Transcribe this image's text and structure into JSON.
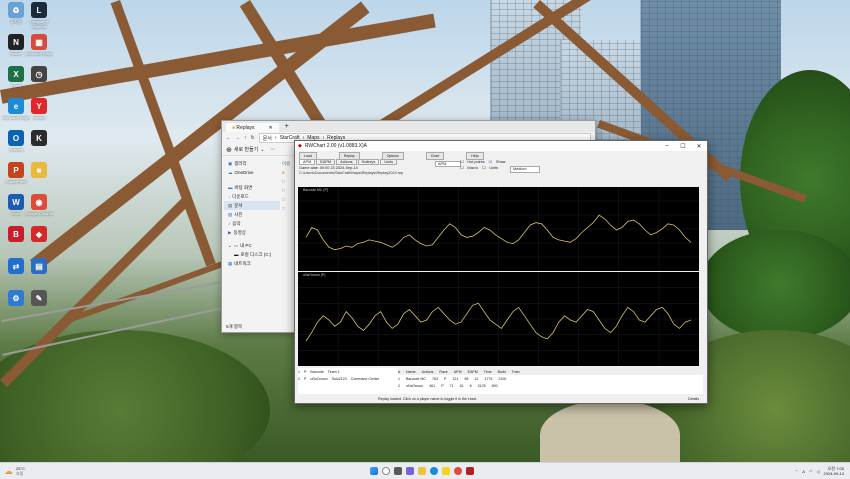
{
  "desktop_icons": [
    {
      "label": "휴지통",
      "icon": "recycle-bin-icon",
      "color": "#6aa0d8",
      "glyph": "♻"
    },
    {
      "label": "League of Legends",
      "icon": "league-icon",
      "color": "#1c2a3a",
      "glyph": "L"
    },
    {
      "label": "Notion",
      "icon": "notion-icon",
      "color": "#222222",
      "glyph": "N"
    },
    {
      "label": "Microsoft Edge",
      "icon": "calendar-icon",
      "color": "#d9493e",
      "glyph": "▦"
    },
    {
      "label": "Excel",
      "icon": "excel-icon",
      "color": "#1e7145",
      "glyph": "X"
    },
    {
      "label": "",
      "icon": "clock-icon",
      "color": "#444444",
      "glyph": "◷"
    },
    {
      "label": "Microsoft Edge",
      "icon": "edge-icon",
      "color": "#1b8ad8",
      "glyph": "e"
    },
    {
      "label": "Yandex",
      "icon": "yandex-icon",
      "color": "#e3262c",
      "glyph": "Y"
    },
    {
      "label": "Outlook",
      "icon": "outlook-icon",
      "color": "#0a64b4",
      "glyph": "O"
    },
    {
      "label": "",
      "icon": "app-icon",
      "color": "#2b2b2b",
      "glyph": "K"
    },
    {
      "label": "PowerPoint",
      "icon": "powerpoint-icon",
      "color": "#c4441e",
      "glyph": "P"
    },
    {
      "label": "",
      "icon": "folder-icon",
      "color": "#e8b93c",
      "glyph": "■"
    },
    {
      "label": "Word",
      "icon": "word-icon",
      "color": "#1c5bb5",
      "glyph": "W"
    },
    {
      "label": "Google Chrome",
      "icon": "chrome-icon",
      "color": "#dd4b39",
      "glyph": "◉"
    },
    {
      "label": "",
      "icon": "bandizip-icon",
      "color": "#c81e2c",
      "glyph": "B"
    },
    {
      "label": "",
      "icon": "v3-icon",
      "color": "#d62828",
      "glyph": "◆"
    },
    {
      "label": "",
      "icon": "teamviewer-icon",
      "color": "#1f6fd0",
      "glyph": "⇄"
    },
    {
      "label": "",
      "icon": "calc-icon",
      "color": "#2b6cc4",
      "glyph": "▤"
    },
    {
      "label": "",
      "icon": "network-icon",
      "color": "#2d7bd5",
      "glyph": "⚙"
    },
    {
      "label": "",
      "icon": "tool-icon",
      "color": "#555555",
      "glyph": "✎"
    }
  ],
  "explorer": {
    "tab_title": "Replays",
    "breadcrumb": [
      "문서",
      "StarCraft",
      "Maps",
      "Replays"
    ],
    "new_button": "새로 만들기",
    "sidebar": [
      "갤러리",
      "OneDrive",
      "바탕 화면",
      "다운로드",
      "문서",
      "사진",
      "음악",
      "동영상",
      "내 PC",
      "로컬 디스크 (C:)",
      "네트워크"
    ],
    "list_header": "이름",
    "list_items": [
      "Rand",
      "rep",
      "rep",
      "rep",
      "rep"
    ],
    "status": "5개 항목"
  },
  "rwchart": {
    "title": "RWChart 2.00 (v1.0883.X)A",
    "toolbar": [
      "Load",
      "Replay",
      "Options",
      "Chart",
      "Help"
    ],
    "tab_labels": [
      "APM",
      "EAPM",
      "Actions",
      "Hotkeys",
      "Units"
    ],
    "replay_info": "Game date: 00:00 23 2024-Sep-14",
    "file_path": "C:\\Users\\Documents\\StarCraft\\Maps\\Replays\\Replay2024.rep",
    "chart_type_select": "APM",
    "smoothing_select": "Medium",
    "options": [
      "Hot points",
      "Show",
      "Macro",
      "Units"
    ],
    "chart1_label": "Barcode MC (P)",
    "chart2_label": "uNxOnoon (P)",
    "table_headers": [
      "#",
      "Name",
      "Actions",
      "Race",
      "APM",
      "EAPM",
      "Time",
      "Build",
      "Train"
    ],
    "table_rows": [
      [
        "1",
        "Barcode MC",
        "763",
        "P",
        "121",
        "98",
        "12",
        "1775",
        "2100"
      ],
      [
        "2",
        "uNxOnoon",
        "461",
        "P",
        "71",
        "61",
        "8",
        "3125",
        "800"
      ]
    ],
    "player_rows": [
      {
        "num": "1",
        "race": "P",
        "name": "Barcode",
        "actions": "SoloPlayer",
        "team": "Team 1"
      },
      {
        "num": "2",
        "race": "P",
        "name": "uNxOnoon",
        "actions": "Solo2123",
        "team": "Command Center"
      }
    ],
    "status_text": "Replay loaded. Click on a player name to toggle it in the chart.",
    "right_status": "Details"
  },
  "taskbar": {
    "weather_temp": "25°C",
    "weather_desc": "흐림",
    "time": "오전 7:05",
    "date": "2024-09-14",
    "lang": "A"
  },
  "chart_data": [
    {
      "type": "line",
      "title": "Barcode MC (P)",
      "series": [
        {
          "name": "APM",
          "values": [
            120,
            160,
            150,
            110,
            80,
            70,
            75,
            85,
            80,
            95,
            100,
            110,
            105,
            100,
            90,
            80,
            95,
            120,
            130,
            110,
            95,
            85,
            90,
            120,
            150,
            175,
            160,
            130,
            120,
            125,
            140,
            160,
            150,
            130,
            115,
            100,
            95,
            110,
            140,
            170,
            180,
            175,
            150,
            120,
            110,
            105,
            100,
            115,
            140,
            160,
            180,
            210,
            195,
            170,
            150,
            160,
            185,
            190,
            175,
            150,
            130,
            140,
            155,
            175,
            170,
            150,
            120,
            100
          ]
        }
      ],
      "ylim": [
        0,
        300
      ]
    },
    {
      "type": "line",
      "title": "uNxOnoon (P)",
      "series": [
        {
          "name": "APM",
          "values": [
            50,
            70,
            95,
            110,
            100,
            85,
            95,
            120,
            105,
            85,
            75,
            90,
            110,
            120,
            95,
            80,
            90,
            115,
            125,
            110,
            95,
            100,
            120,
            130,
            115,
            100,
            90,
            95,
            115,
            135,
            140,
            120,
            100,
            90,
            80,
            100,
            120,
            130,
            110,
            90,
            70,
            60,
            55,
            70,
            95,
            110,
            100,
            95,
            110,
            125,
            120,
            100,
            80,
            70,
            85,
            110,
            130,
            120,
            100,
            95,
            110,
            125,
            130,
            115,
            90,
            80,
            95,
            100
          ]
        }
      ],
      "ylim": [
        0,
        200
      ]
    }
  ]
}
